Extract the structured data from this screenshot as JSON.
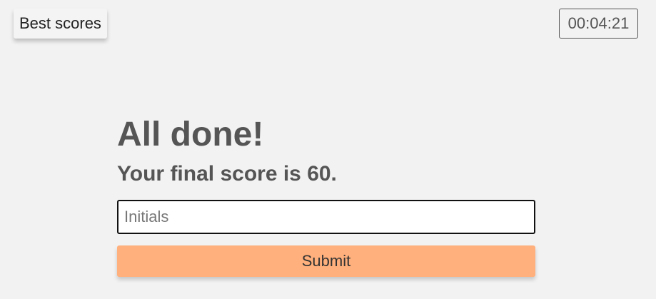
{
  "header": {
    "best_scores_label": "Best scores",
    "timer": "00:04:21"
  },
  "main": {
    "title": "All done!",
    "score_text": "Your final score is 60.",
    "initials_placeholder": "Initials",
    "initials_value": "",
    "submit_label": "Submit"
  },
  "colors": {
    "background": "#f2f2f2",
    "text": "#555555",
    "submit_accent": "#ffb07c"
  }
}
